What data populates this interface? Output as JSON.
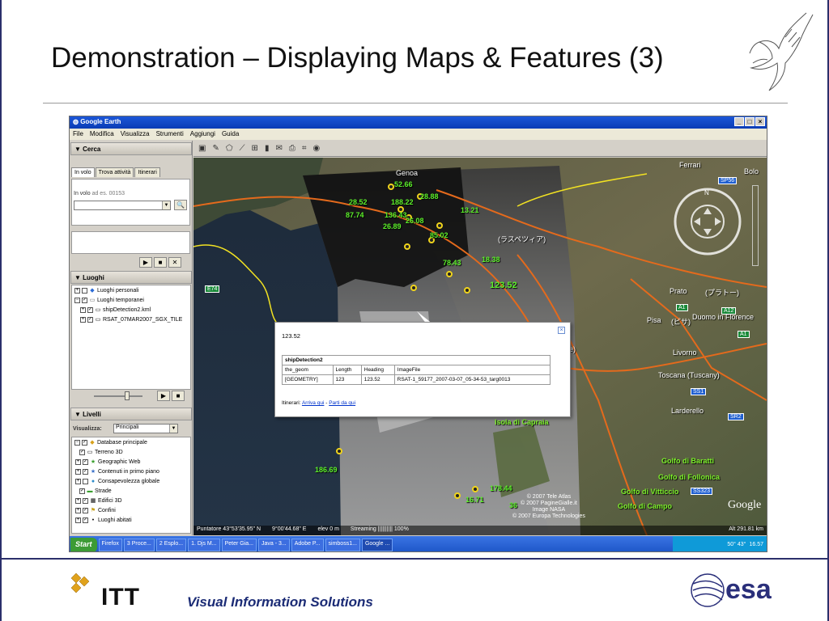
{
  "slide": {
    "title": "Demonstration – Displaying Maps & Features (3)",
    "footer_brand": "ITT",
    "footer_text": "Visual Information Solutions",
    "esa_logo_text": "esa"
  },
  "window": {
    "title": "Google Earth",
    "menu": [
      "File",
      "Modifica",
      "Visualizza",
      "Strumenti",
      "Aggiungi",
      "Guida"
    ]
  },
  "search_panel": {
    "heading": "Cerca",
    "tabs": [
      "In volo",
      "Trova attività",
      "Itinerari"
    ],
    "fly_label": "In volo",
    "fly_hint": "ad es. 00153"
  },
  "places_panel": {
    "heading": "Luoghi",
    "items": [
      {
        "label": "Luoghi personali",
        "icon": "folder-icon"
      },
      {
        "label": "Luoghi temporanei",
        "icon": "folder-icon"
      },
      {
        "label": "shipDetection2.kml",
        "icon": "folder-icon"
      },
      {
        "label": "RSAT_07MAR2007_SGX_TILE",
        "icon": "folder-icon"
      }
    ]
  },
  "layers_panel": {
    "heading": "Livelli",
    "view_label": "Visualizza:",
    "view_value": "Principali",
    "items": [
      {
        "label": "Database principale"
      },
      {
        "label": "Terreno 3D"
      },
      {
        "label": "Geographic Web"
      },
      {
        "label": "Contenuti in primo piano"
      },
      {
        "label": "Consapevolezza globale"
      },
      {
        "label": "Strade"
      },
      {
        "label": "Edifici 3D"
      },
      {
        "label": "Confini"
      },
      {
        "label": "Luoghi abitati"
      }
    ]
  },
  "map": {
    "ship_labels": [
      {
        "text": "52.66"
      },
      {
        "text": "28.52"
      },
      {
        "text": "188.22"
      },
      {
        "text": "28.88"
      },
      {
        "text": "87.74"
      },
      {
        "text": "136.43"
      },
      {
        "text": "26.08"
      },
      {
        "text": "13.21"
      },
      {
        "text": "26.89"
      },
      {
        "text": "85.02"
      },
      {
        "text": "78.43"
      },
      {
        "text": "18.38"
      },
      {
        "text": "123.52"
      },
      {
        "text": "186.69"
      },
      {
        "text": "178.44"
      },
      {
        "text": "16.71"
      },
      {
        "text": "36"
      }
    ],
    "place_labels": [
      {
        "text": "Genoa"
      },
      {
        "text": "(ラスペツィア)"
      },
      {
        "text": "Prato"
      },
      {
        "text": "(プラトー)"
      },
      {
        "text": "Pisa"
      },
      {
        "text": "(ピサ)"
      },
      {
        "text": "Duomo in Florence"
      },
      {
        "text": "Livorno"
      },
      {
        "text": "rne)"
      },
      {
        "text": "Toscana (Tuscany)"
      },
      {
        "text": "Larderello"
      },
      {
        "text": "Isola di Capraia"
      },
      {
        "text": "Golfo di Baratti"
      },
      {
        "text": "Golfo di Follonica"
      },
      {
        "text": "Golfo di Vitticcio"
      },
      {
        "text": "Golfo di Campo"
      },
      {
        "text": "Ferrari"
      },
      {
        "text": "Bolo"
      }
    ],
    "road_badges": [
      "E74",
      "SP56",
      "A1",
      "A1",
      "A12",
      "SS1",
      "SR2",
      "SS323"
    ],
    "credits": [
      "© 2007 Tele Atlas",
      "© 2007 PagineGialle.it",
      "Image NASA",
      "© 2007 Europa Technologies"
    ],
    "google_mark": "Google",
    "status": {
      "pointer": "Puntatore 43°53'35.95\" N",
      "lon": "9°00'44.68\" E",
      "elev": "elev 0 m",
      "streaming": "Streaming |||||||||| 100%",
      "alt": "Alt 291.81 km"
    },
    "balloon": {
      "title": "123.52",
      "table_title": "shipDetection2",
      "columns": [
        "the_geom",
        "Length",
        "Heading",
        "ImageFile"
      ],
      "row": [
        "[GEOMETRY]",
        "123",
        "123.52",
        "RSAT-1_59177_2007-03-07_05-34-53_targ0013"
      ],
      "route_label": "Itinerari:",
      "link_here": "Arriva qui",
      "separator": "-",
      "link_from": "Parti da qui"
    }
  },
  "taskbar": {
    "start": "Start",
    "tasks": [
      "Firefox",
      "3 Proce...",
      "2 Esplo...",
      "1. Djs M...",
      "Peter Gia...",
      "Java - 3...",
      "Adobe P...",
      "simboss1...",
      "Google ..."
    ],
    "tray_time": "16.57",
    "tray_temp": "50° 43°"
  }
}
